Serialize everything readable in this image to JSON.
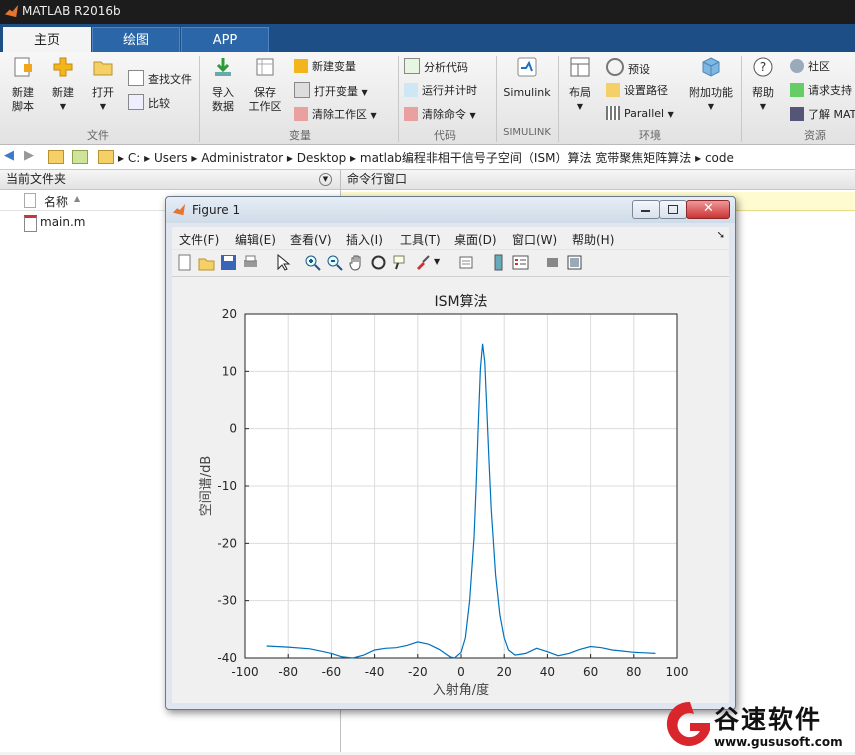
{
  "app": {
    "title": "MATLAB R2016b"
  },
  "tabs": [
    {
      "label": "主页"
    },
    {
      "label": "绘图"
    },
    {
      "label": "APP"
    }
  ],
  "ribbon": {
    "file": {
      "group": "文件",
      "new_script": "新建\n脚本",
      "new": "新建",
      "open": "打开",
      "find_files": "查找文件",
      "compare": "比较"
    },
    "variable": {
      "group": "变量",
      "import": "导入\n数据",
      "save_ws": "保存\n工作区",
      "new_var": "新建变量",
      "open_var": "打开变量",
      "clear_ws": "清除工作区"
    },
    "code": {
      "group": "代码",
      "analyze": "分析代码",
      "run_time": "运行并计时",
      "clear_cmd": "清除命令"
    },
    "simulink": {
      "group": "SIMULINK",
      "label": "Simulink"
    },
    "env": {
      "group": "环境",
      "layout": "布局",
      "prefs": "预设",
      "set_path": "设置路径",
      "parallel": "Parallel",
      "addons": "附加功能"
    },
    "resources": {
      "group": "资源",
      "help": "帮助",
      "community": "社区",
      "request": "请求支持",
      "learn": "了解 MATL"
    }
  },
  "address": {
    "crumbs": [
      "C:",
      "Users",
      "Administrator",
      "Desktop",
      "matlab编程非相干信号子空间（ISM）算法 宽带聚焦矩阵算法",
      "code"
    ]
  },
  "left_pane": {
    "title": "当前文件夹",
    "col_name": "名称",
    "files": [
      {
        "name": "main.m"
      }
    ]
  },
  "right_pane": {
    "title": "命令行窗口"
  },
  "figure": {
    "title": "Figure 1",
    "menu": [
      "文件(F)",
      "编辑(E)",
      "查看(V)",
      "插入(I)",
      "工具(T)",
      "桌面(D)",
      "窗口(W)",
      "帮助(H)"
    ]
  },
  "chart_data": {
    "type": "line",
    "title": "ISM算法",
    "xlabel": "入射角/度",
    "ylabel": "空间谱/dB",
    "xlim": [
      -100,
      100
    ],
    "ylim": [
      -40,
      20
    ],
    "xticks": [
      -100,
      -80,
      -60,
      -40,
      -20,
      0,
      20,
      40,
      60,
      80,
      100
    ],
    "yticks": [
      20,
      10,
      0,
      -10,
      -20,
      -30,
      -40
    ],
    "grid": true,
    "color": "#0072BD",
    "series": [
      {
        "x": [
          -90,
          -80,
          -70,
          -65,
          -60,
          -55,
          -50,
          -45,
          -40,
          -35,
          -30,
          -25,
          -20,
          -15,
          -10,
          -5,
          -3,
          0,
          2,
          4,
          6,
          7,
          8,
          9,
          10,
          11,
          12,
          13,
          14,
          16,
          18,
          20,
          22,
          25,
          30,
          35,
          40,
          45,
          50,
          55,
          60,
          65,
          70,
          75,
          80,
          85,
          90
        ],
        "y": [
          -37.9,
          -38.1,
          -38.4,
          -38.8,
          -39.2,
          -39.8,
          -40.0,
          -39.5,
          -38.6,
          -38.3,
          -38.2,
          -37.8,
          -37.2,
          -37.6,
          -38.5,
          -39.8,
          -40.0,
          -39.0,
          -36.5,
          -30.0,
          -19.0,
          -10.0,
          1.0,
          10.5,
          14.8,
          11.5,
          3.0,
          -6.0,
          -14.0,
          -25.5,
          -32.5,
          -36.5,
          -38.6,
          -39.5,
          -39.2,
          -38.3,
          -38.9,
          -39.6,
          -39.2,
          -38.5,
          -38.0,
          -38.2,
          -38.6,
          -38.8,
          -39.0,
          -39.1,
          -39.2
        ]
      }
    ]
  },
  "watermark": {
    "brand": "谷速软件",
    "url": "www.gususoft.com"
  }
}
